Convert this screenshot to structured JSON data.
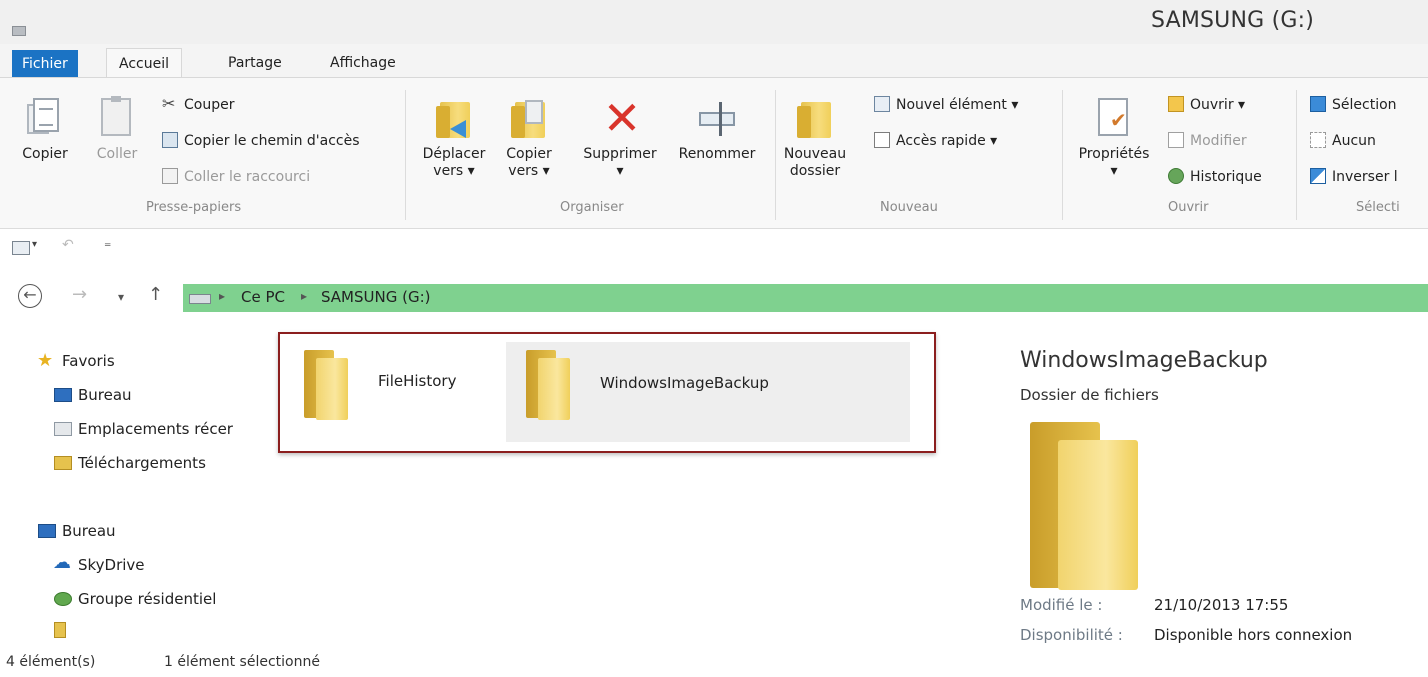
{
  "window": {
    "title": "SAMSUNG (G:)"
  },
  "tabs": {
    "file": "Fichier",
    "home": "Accueil",
    "share": "Partage",
    "view": "Affichage"
  },
  "ribbon": {
    "clipboard": {
      "label": "Presse-papiers",
      "copy": "Copier",
      "paste": "Coller",
      "cut": "Couper",
      "copy_path": "Copier le chemin d'accès",
      "paste_shortcut": "Coller le raccourci"
    },
    "organize": {
      "label": "Organiser",
      "move_to_1": "Déplacer",
      "move_to_2": "vers ▾",
      "copy_to_1": "Copier",
      "copy_to_2": "vers ▾",
      "delete": "Supprimer",
      "delete_arrow": "▾",
      "rename": "Renommer"
    },
    "new": {
      "label": "Nouveau",
      "new_folder_1": "Nouveau",
      "new_folder_2": "dossier",
      "new_item": "Nouvel élément ▾",
      "easy_access": "Accès rapide ▾"
    },
    "open": {
      "label": "Ouvrir",
      "properties": "Propriétés",
      "properties_arrow": "▾",
      "open": "Ouvrir ▾",
      "edit": "Modifier",
      "history": "Historique"
    },
    "select": {
      "label": "Sélecti",
      "select_all": "Sélection",
      "select_none": "Aucun",
      "invert": "Inverser l"
    }
  },
  "address": {
    "crumbs": [
      "Ce PC",
      "SAMSUNG (G:)"
    ]
  },
  "navpane": {
    "favorites": "Favoris",
    "desktop": "Bureau",
    "recent": "Emplacements récer",
    "downloads": "Téléchargements",
    "desktop2": "Bureau",
    "skydrive": "SkyDrive",
    "homegroup": "Groupe résidentiel"
  },
  "files": [
    {
      "name": "FileHistory"
    },
    {
      "name": "WindowsImageBackup"
    }
  ],
  "details": {
    "title": "WindowsImageBackup",
    "type": "Dossier de fichiers",
    "modified_label": "Modifié le :",
    "modified_value": "21/10/2013 17:55",
    "availability_label": "Disponibilité :",
    "availability_value": "Disponible hors connexion"
  },
  "status": {
    "count": "4 élément(s)",
    "selected": "1 élément sélectionné"
  }
}
